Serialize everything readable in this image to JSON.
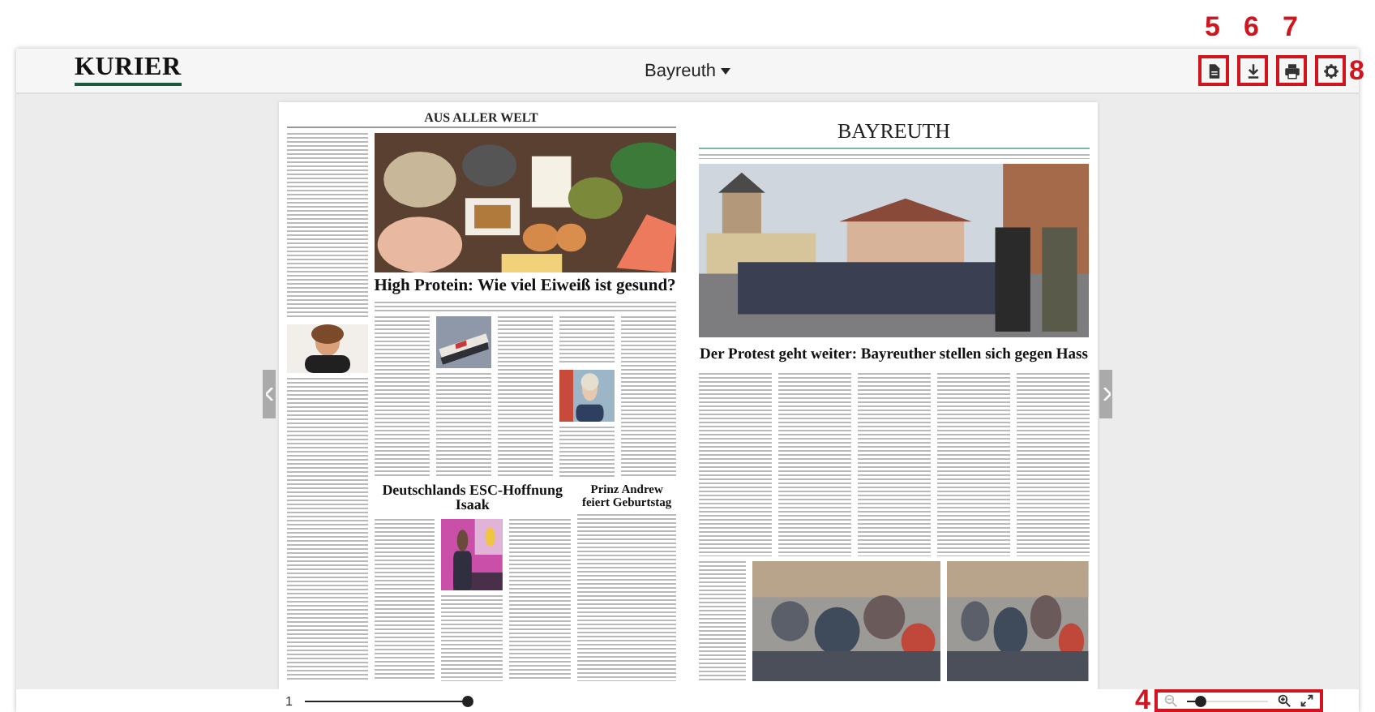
{
  "header": {
    "logo": "KURIER",
    "edition": "Bayreuth"
  },
  "toolbar": [
    {
      "kind": "document",
      "callout": "5"
    },
    {
      "kind": "download",
      "callout": "6"
    },
    {
      "kind": "print",
      "callout": "7"
    },
    {
      "kind": "settings",
      "callout": "8"
    }
  ],
  "left_page": {
    "section": "AUS ALLER WELT",
    "headline": "High Protein: Wie viel Eiweiß ist gesund?",
    "second_headline": "Deutschlands ESC-Hoffnung Isaak",
    "side_headline": "Prinz Andrew feiert Geburtstag"
  },
  "right_page": {
    "section": "BAYREUTH",
    "headline": "Der Protest geht weiter: Bayreuther stellen sich gegen Hass"
  },
  "footer": {
    "page": "1",
    "page_slider": {
      "level": 1
    },
    "zoom": {
      "callout": "4",
      "slider": {
        "level": 0.15
      }
    }
  }
}
